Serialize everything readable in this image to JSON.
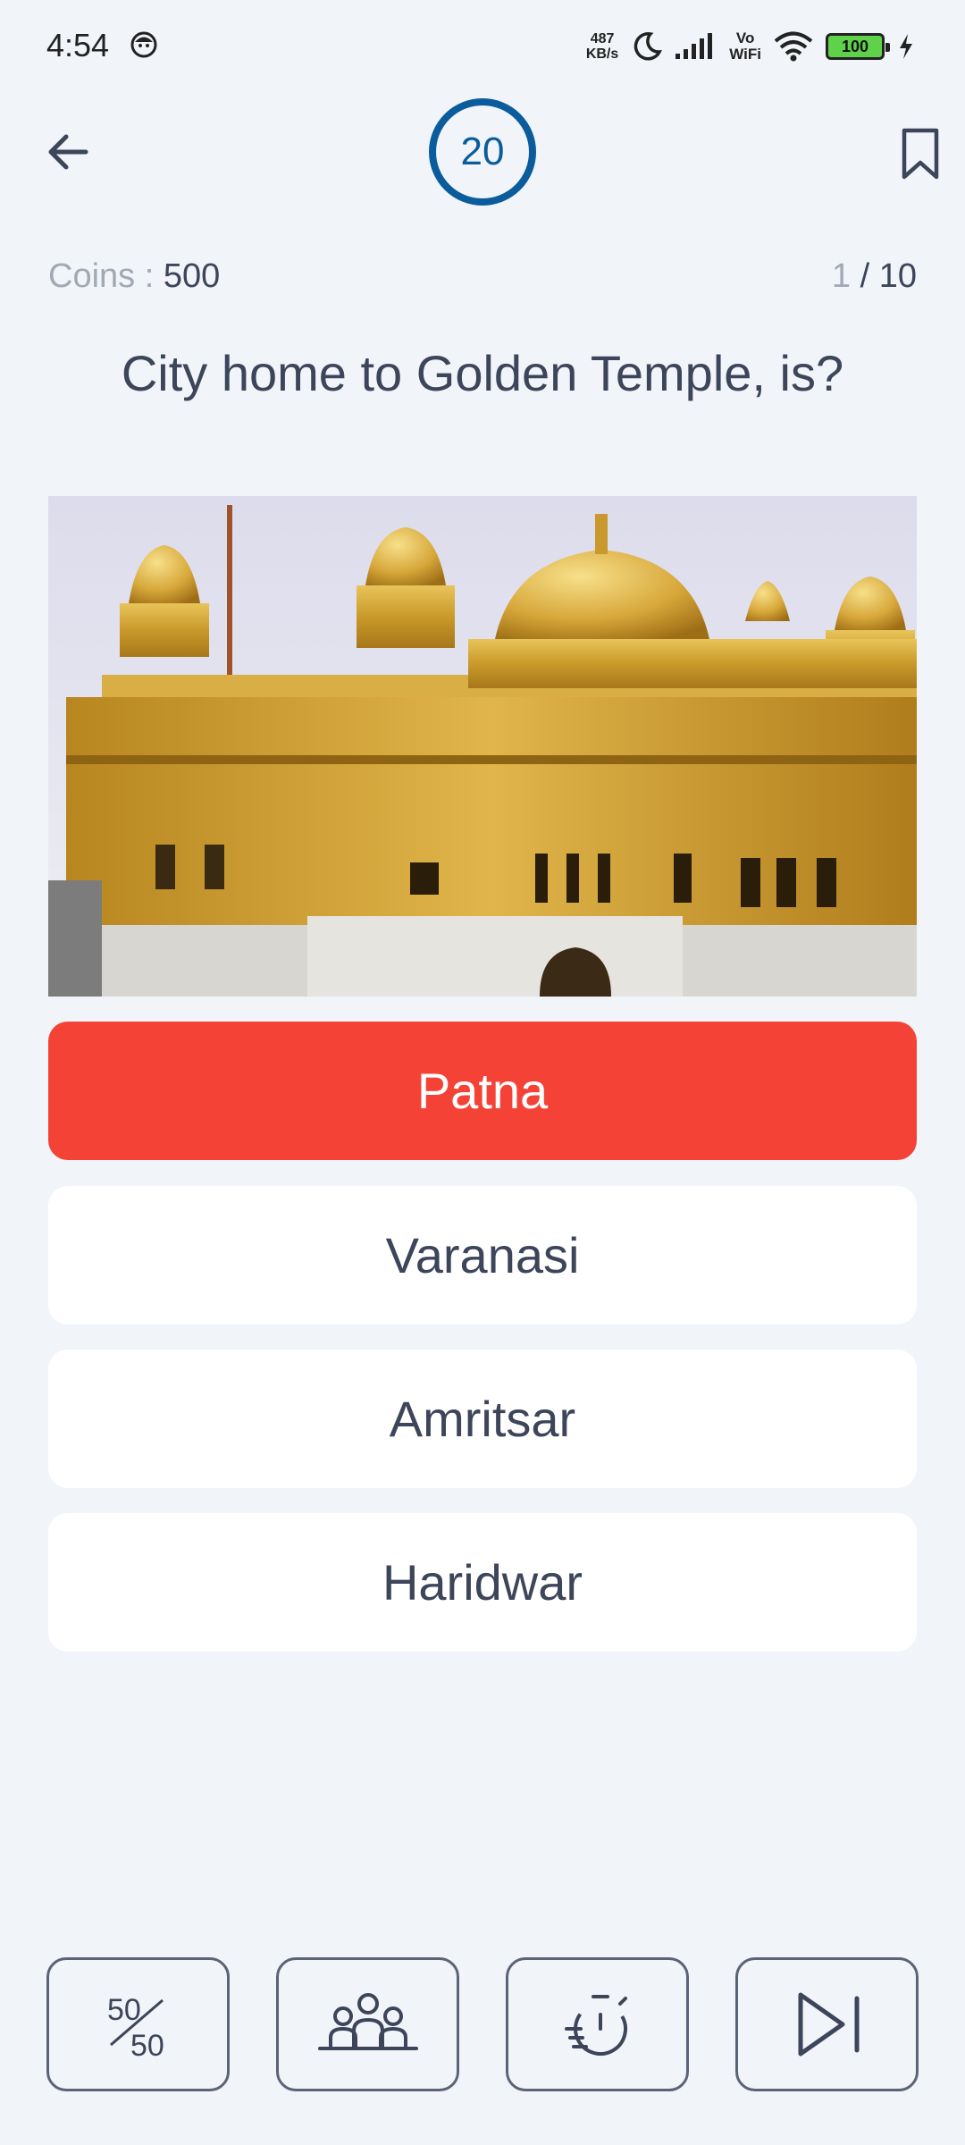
{
  "status_bar": {
    "time": "4:54",
    "net_speed_value": "487",
    "net_speed_unit": "KB/s",
    "vowifi_top": "Vo",
    "vowifi_bottom": "WiFi",
    "battery": "100"
  },
  "header": {
    "timer": "20"
  },
  "stats": {
    "coins_label": "Coins : ",
    "coins_value": "500",
    "progress_current": "1",
    "progress_total": " / 10"
  },
  "question": "City home to Golden Temple, is?",
  "options": [
    {
      "label": "Patna",
      "state": "wrong"
    },
    {
      "label": "Varanasi",
      "state": "default"
    },
    {
      "label": "Amritsar",
      "state": "default"
    },
    {
      "label": "Haridwar",
      "state": "default"
    }
  ],
  "lifelines": [
    {
      "icon": "fifty-fifty-icon",
      "text_top": "50",
      "text_bottom": "50"
    },
    {
      "icon": "audience-poll-icon"
    },
    {
      "icon": "timer-reset-icon"
    },
    {
      "icon": "skip-icon"
    }
  ],
  "colors": {
    "background": "#f1f4f9",
    "accent": "#0a5c9c",
    "wrong": "#f44336",
    "text": "#3c4559",
    "muted": "#a2a9b5"
  }
}
